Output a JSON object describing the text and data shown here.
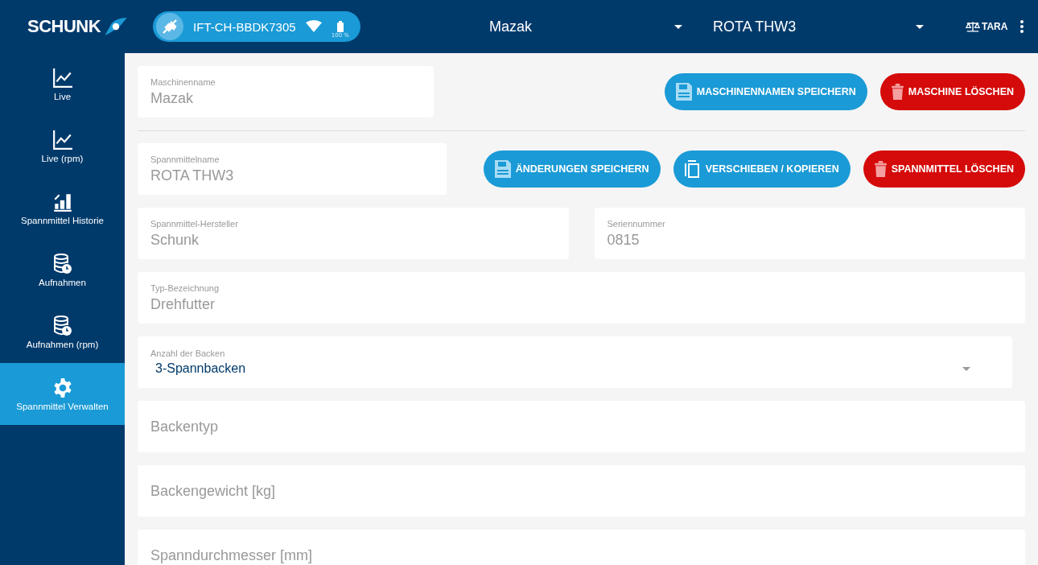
{
  "header": {
    "logo": "SCHUNK",
    "device": {
      "name": "IFT-CH-BBDK7305",
      "battery": "100 %"
    },
    "machine_select": "Mazak",
    "tool_select": "ROTA THW3",
    "tara": "TARA"
  },
  "sidebar": {
    "items": [
      {
        "label": "Live",
        "kind": "chart",
        "selected": false
      },
      {
        "label": "Live (rpm)",
        "kind": "chart",
        "selected": false
      },
      {
        "label": "Spannmittel Historie",
        "kind": "history",
        "selected": false
      },
      {
        "label": "Aufnahmen",
        "kind": "recordings",
        "selected": false
      },
      {
        "label": "Aufnahmen (rpm)",
        "kind": "recordings",
        "selected": false
      },
      {
        "label": "Spannmittel Verwalten",
        "kind": "settings",
        "selected": true
      }
    ]
  },
  "machine": {
    "field": {
      "label": "Maschinenname",
      "value": "Mazak"
    },
    "buttons": [
      {
        "label": "MASCHINENNAMEN SPEICHERN",
        "kind": "save"
      },
      {
        "label": "MASCHINE LÖSCHEN",
        "kind": "delete"
      }
    ]
  },
  "tool": {
    "field": {
      "label": "Spannmittelname",
      "value": "ROTA THW3"
    },
    "buttons": [
      {
        "label": "ÄNDERUNGEN SPEICHERN",
        "kind": "save"
      },
      {
        "label": "VERSCHIEBEN / KOPIEREN",
        "kind": "copy"
      },
      {
        "label": "SPANNMITTEL LÖSCHEN",
        "kind": "delete"
      }
    ]
  },
  "form_rows": [
    [
      {
        "kind": "text",
        "label": "Spannmittel-Hersteller",
        "value": "Schunk"
      },
      {
        "kind": "text",
        "label": "Seriennummer",
        "value": "0815"
      }
    ],
    [
      {
        "kind": "text",
        "label": "Typ-Bezeichnung",
        "value": "Drehfutter"
      }
    ],
    [
      {
        "kind": "select",
        "label": "Anzahl der Backen",
        "value": "3-Spannbacken"
      }
    ],
    [
      {
        "kind": "empty",
        "placeholder": "Backentyp"
      }
    ],
    [
      {
        "kind": "empty",
        "placeholder": "Backengewicht [kg]"
      }
    ],
    [
      {
        "kind": "empty",
        "placeholder": "Spanndurchmesser [mm]"
      }
    ]
  ]
}
